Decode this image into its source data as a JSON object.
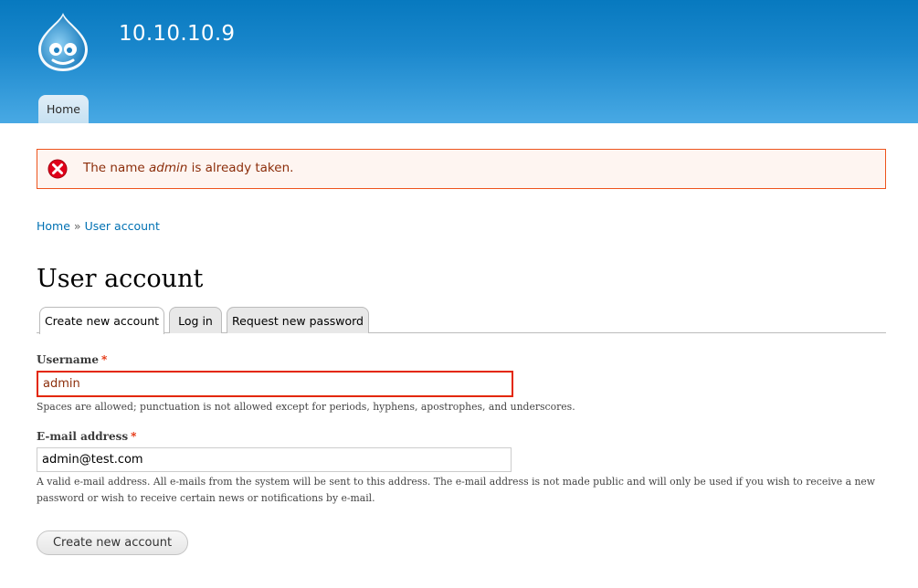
{
  "header": {
    "site_name": "10.10.10.9",
    "primary_tabs": [
      {
        "label": "Home"
      }
    ]
  },
  "message": {
    "prefix": "The name ",
    "name": "admin",
    "suffix": " is already taken."
  },
  "breadcrumb": {
    "items": [
      "Home",
      "User account"
    ],
    "separator": "»"
  },
  "page_title": "User account",
  "tabs": [
    {
      "label": "Create new account",
      "active": true
    },
    {
      "label": "Log in",
      "active": false
    },
    {
      "label": "Request new password",
      "active": false
    }
  ],
  "form": {
    "username": {
      "label": "Username",
      "required_marker": "*",
      "value": "admin",
      "description": "Spaces are allowed; punctuation is not allowed except for periods, hyphens, apostrophes, and underscores."
    },
    "email": {
      "label": "E-mail address",
      "required_marker": "*",
      "value": "admin@test.com",
      "description": "A valid e-mail address. All e-mails from the system will be sent to this address. The e-mail address is not made public and will only be used if you wish to receive a new password or wish to receive certain news or notifications by e-mail."
    },
    "submit_label": "Create new account"
  },
  "colors": {
    "header_top": "#0779bf",
    "header_bottom": "#48a9e4",
    "link": "#0071b3",
    "error_border": "#ed541d",
    "error_text": "#8c2e0b",
    "required": "#e32700"
  },
  "icons": {
    "logo": "drupal-drop-logo",
    "error": "error-x-icon"
  }
}
